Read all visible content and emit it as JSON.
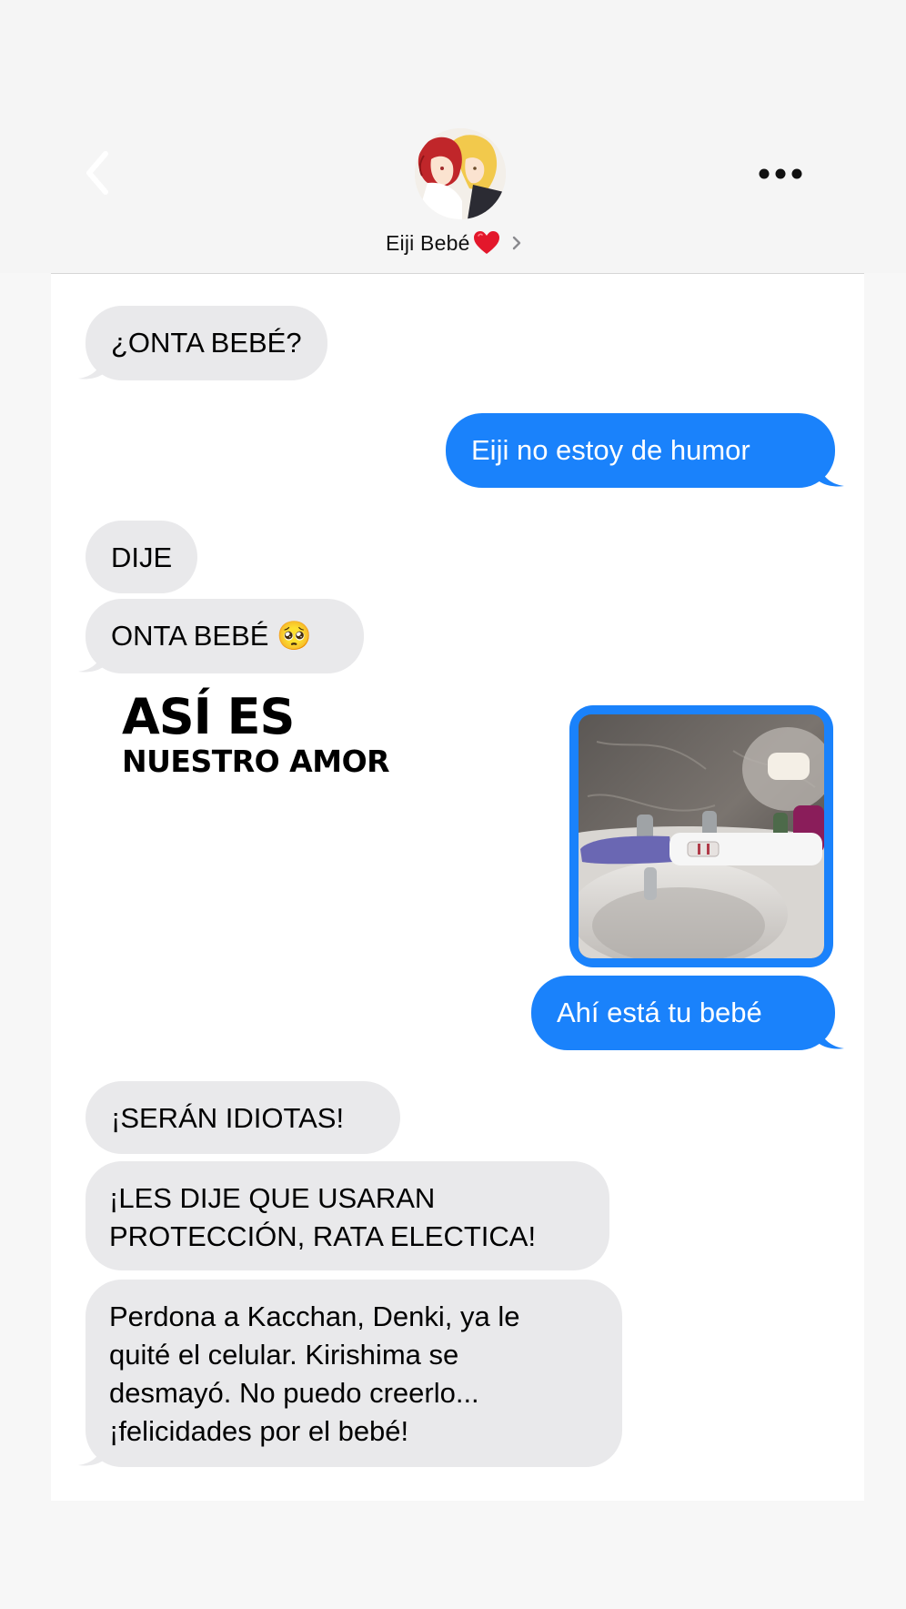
{
  "header": {
    "contact_name": "Eiji Bebé",
    "contact_heart": "❤️"
  },
  "overlay": {
    "title_line1": "ASÍ ES",
    "title_line2": "NUESTRO AMOR"
  },
  "messages": [
    {
      "from": "received",
      "text": "¿ONTA BEBÉ?"
    },
    {
      "from": "sent",
      "text": "Eiji no estoy de humor"
    },
    {
      "from": "received",
      "text": "DIJE"
    },
    {
      "from": "received",
      "text": "ONTA BEBÉ 🥺"
    },
    {
      "from": "sent",
      "type": "image"
    },
    {
      "from": "sent",
      "text": "Ahí está tu bebé"
    },
    {
      "from": "received",
      "text": "¡SERÁN IDIOTAS!"
    },
    {
      "from": "received",
      "lines": [
        "¡LES DIJE QUE USARAN",
        "PROTECCIÓN, RATA ELECTICA!"
      ]
    },
    {
      "from": "received",
      "lines": [
        "Perdona a Kacchan, Denki, ya le",
        "quité el celular. Kirishima se",
        "desmayó. No puedo creerlo...",
        "¡felicidades por el bebé!"
      ]
    }
  ],
  "colors": {
    "sent_bubble": "#1a82fb",
    "received_bubble": "#e9e9eb",
    "background": "#f7f7f7"
  },
  "icons": {
    "back": "chevron-left-icon",
    "more": "ellipsis-icon",
    "contact_chevron": "chevron-right-icon"
  }
}
